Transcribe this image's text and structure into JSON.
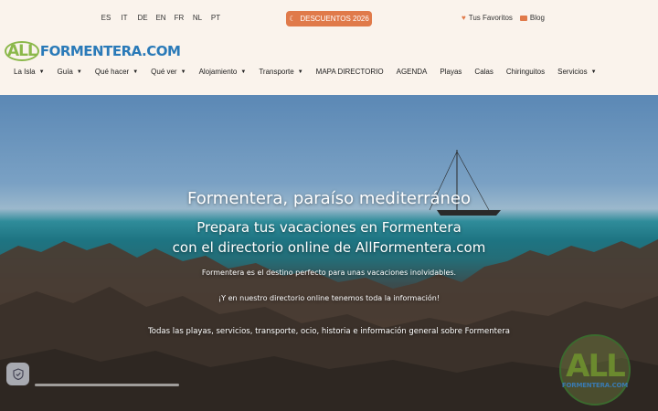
{
  "languages": [
    "ES",
    "IT",
    "DE",
    "EN",
    "FR",
    "NL",
    "PT"
  ],
  "promo": {
    "label": "DESCUENTOS 2026",
    "icon": "moon-icon"
  },
  "toplinks": {
    "favorites": "Tus Favoritos",
    "blog": "Blog"
  },
  "logo": {
    "part1": "ALL",
    "part2": "FORMENTERA.COM"
  },
  "nav": [
    {
      "label": "La Isla",
      "dropdown": true
    },
    {
      "label": "Guía",
      "dropdown": true
    },
    {
      "label": "Qué hacer",
      "dropdown": true
    },
    {
      "label": "Qué ver",
      "dropdown": true
    },
    {
      "label": "Alojamiento",
      "dropdown": true
    },
    {
      "label": "Transporte",
      "dropdown": true
    },
    {
      "label": "MAPA DIRECTORIO",
      "dropdown": false
    },
    {
      "label": "AGENDA",
      "dropdown": false
    },
    {
      "label": "Playas",
      "dropdown": false
    },
    {
      "label": "Calas",
      "dropdown": false
    },
    {
      "label": "Chiringuitos",
      "dropdown": false
    },
    {
      "label": "Servicios",
      "dropdown": true
    }
  ],
  "hero": {
    "title": "Formentera, paraíso mediterráneo",
    "subtitle1": "Prepara tus vacaciones en Formentera",
    "subtitle2": "con el directorio online de AllFormentera.com",
    "para1": "Formentera es el destino perfecto para unas vacaciones inolvidables.",
    "para2": "¡Y en nuestro directorio online tenemos toda la información!",
    "para3": "Todas las playas, servicios, transporte, ocio, historia e información general sobre Formentera"
  },
  "watermark": {
    "big": "ALL",
    "small": "FORMENTERA.COM"
  },
  "colors": {
    "accent": "#e07a4a",
    "logo_green": "#8bb84a",
    "logo_blue": "#2a7ab8",
    "topbar_bg": "#faf3ec"
  }
}
